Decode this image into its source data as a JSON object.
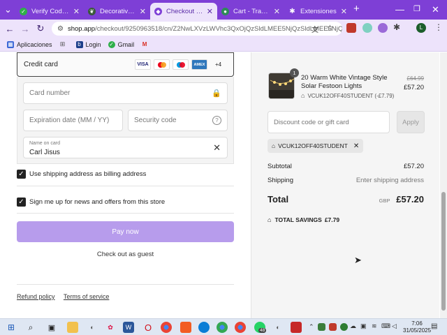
{
  "browser": {
    "tabs": [
      {
        "label": "Verify Codes —",
        "icon": "check-favicon",
        "color": "#2faf4a"
      },
      {
        "label": "Decorative Ligh",
        "icon": "leaf-favicon",
        "color": "#3a5a3a"
      },
      {
        "label": "Checkout - Ligh",
        "icon": "tag-favicon",
        "color": "#7e3fd6",
        "active": true
      },
      {
        "label": "Cart - Trampoli",
        "icon": "globe-favicon",
        "color": "#2e8b57"
      },
      {
        "label": "Extensiones",
        "icon": "puzzle-favicon",
        "color": "#555"
      }
    ],
    "url_host": "shop.app",
    "url_path": "/checkout/9250963518/cn/Z2NwLXVzLWVhc3QxOjQzSldLMEE5NjQzSldLMEE5NjQz",
    "bookmarks": [
      {
        "label": "Aplicaciones",
        "icon": "apps-icon"
      },
      {
        "label": "",
        "icon": "grid-icon"
      },
      {
        "label": "Login",
        "icon": "login-icon"
      },
      {
        "label": "Gmail",
        "icon": "gmail-icon"
      },
      {
        "label": "",
        "icon": "gmail-m-icon"
      }
    ]
  },
  "payment": {
    "method_label": "Credit card",
    "card_brands": [
      "VISA",
      "MC",
      "MAE",
      "AMEX"
    ],
    "more_brands": "+4",
    "card_number_placeholder": "Card number",
    "expiry_placeholder": "Expiration date (MM / YY)",
    "security_placeholder": "Security code",
    "name_label": "Name on card",
    "name_value": "Carl Jisus",
    "billing_checkbox": "Use shipping address as billing address",
    "newsletter_checkbox": "Sign me up for news and offers from this store",
    "pay_button": "Pay now",
    "guest_link": "Check out as guest",
    "refund_link": "Refund policy",
    "terms_link": "Terms of service"
  },
  "summary": {
    "quantity_badge": "1",
    "product_name": "20 Warm White Vintage Style Solar Festoon Lights",
    "product_code": "VCUK12OFF40STUDENT (-£7.79)",
    "old_price": "£64.99",
    "new_price": "£57.20",
    "discount_placeholder": "Discount code or gift card",
    "apply_button": "Apply",
    "applied_code": "VCUK12OFF40STUDENT",
    "subtotal_label": "Subtotal",
    "subtotal_value": "£57.20",
    "shipping_label": "Shipping",
    "shipping_value": "Enter shipping address",
    "total_label": "Total",
    "currency": "GBP",
    "total_value": "£57.20",
    "savings_label": "TOTAL SAVINGS",
    "savings_value": "£7.79"
  },
  "taskbar": {
    "time": "7:06",
    "date": "31/05/2025",
    "chat_badge": "48"
  },
  "colors": {
    "accent": "#7e3fd6",
    "pay_button": "#b79cec"
  }
}
